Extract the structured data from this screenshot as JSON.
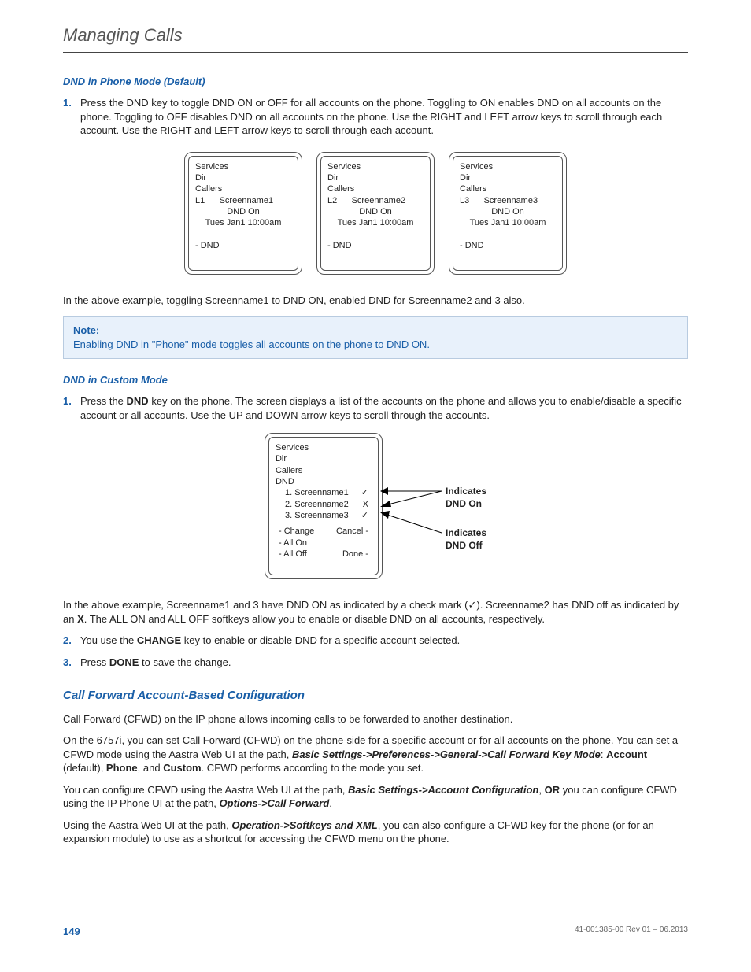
{
  "header": {
    "title": "Managing Calls"
  },
  "section1": {
    "heading": "DND in Phone Mode (Default)",
    "item1_num": "1.",
    "item1_text": "Press the DND key to toggle DND ON or OFF for all accounts on the phone. Toggling to ON enables DND on all accounts on the phone. Toggling to OFF disables DND on all accounts on the phone. Use the RIGHT and LEFT arrow keys to scroll through each account. Use the RIGHT and LEFT arrow keys to scroll through each account."
  },
  "screens": [
    {
      "services": "Services",
      "dir": "Dir",
      "callers": "Callers",
      "line": "L1",
      "name": "Screenname1",
      "dnd": "DND On",
      "time": "Tues Jan1 10:00am",
      "soft": "- DND"
    },
    {
      "services": "Services",
      "dir": "Dir",
      "callers": "Callers",
      "line": "L2",
      "name": "Screenname2",
      "dnd": "DND On",
      "time": "Tues Jan1 10:00am",
      "soft": "- DND"
    },
    {
      "services": "Services",
      "dir": "Dir",
      "callers": "Callers",
      "line": "L3",
      "name": "Screenname3",
      "dnd": "DND On",
      "time": "Tues Jan1 10:00am",
      "soft": "- DND"
    }
  ],
  "para_after_screens": "In the above example, toggling Screenname1 to DND ON, enabled DND for Screenname2 and 3 also.",
  "note": {
    "label": "Note:",
    "body": "Enabling DND in \"Phone\" mode toggles all accounts on the phone to DND ON."
  },
  "section2": {
    "heading": "DND in Custom Mode",
    "item1_num": "1.",
    "item1_pre": "Press the ",
    "item1_bold": "DND",
    "item1_post": " key on the phone. The screen displays a list of the accounts on the phone and allows you to enable/disable a specific account or all accounts. Use the UP and DOWN arrow keys to scroll through the accounts."
  },
  "custom_screen": {
    "services": "Services",
    "dir": "Dir",
    "callers": "Callers",
    "dnd_head": "DND",
    "row1_label": "1. Screenname1",
    "row1_mark": "✓",
    "row2_label": "2. Screenname2",
    "row2_mark": "X",
    "row3_label": "3. Screenname3",
    "row3_mark": "✓",
    "soft_change": "- Change",
    "soft_cancel": "Cancel -",
    "soft_allon": "- All On",
    "soft_done": "Done -",
    "soft_alloff": "- All Off"
  },
  "callouts": {
    "on_l1": "Indicates",
    "on_l2": "DND On",
    "off_l1": "Indicates",
    "off_l2": "DND Off"
  },
  "para_after_custom_1a": "In the above example, Screenname1 and 3 have DND ON as indicated by a check mark (",
  "checkmark": "✓",
  "para_after_custom_1b": "). Screenname2 has DND off as indicated by an ",
  "x_mark": "X",
  "para_after_custom_1c": ". The ALL ON and ALL OFF softkeys allow you to enable or disable DND on all accounts, respectively.",
  "section2_item2_num": "2.",
  "section2_item2_pre": "You use the ",
  "section2_item2_bold": "CHANGE",
  "section2_item2_post": " key to enable or disable DND for a specific account selected.",
  "section2_item3_num": "3.",
  "section2_item3_pre": "Press ",
  "section2_item3_bold": "DONE",
  "section2_item3_post": " to save the change.",
  "cfwd": {
    "heading": "Call Forward Account-Based Configuration",
    "p1": "Call Forward (CFWD) on the IP phone allows incoming calls to be forwarded to another destination.",
    "p2_a": "On the 6757i, you can set Call Forward (CFWD) on the phone-side for a specific account or for all accounts on the phone. You can set a CFWD mode using the Aastra Web UI at the path, ",
    "p2_b": "Basic Settings->Preferences->General->Call Forward Key Mode",
    "p2_c": ": ",
    "p2_d": "Account",
    "p2_e": " (default), ",
    "p2_f": "Phone",
    "p2_g": ", and ",
    "p2_h": "Custom",
    "p2_i": ". CFWD performs according to the mode you set.",
    "p3_a": "You can configure CFWD using the Aastra Web UI at the path, ",
    "p3_b": "Basic Settings->Account Configuration",
    "p3_c": ", ",
    "p3_d": "OR",
    "p3_e": " you can configure CFWD using the IP Phone UI at the path, ",
    "p3_f": "Options->Call Forward",
    "p3_g": ".",
    "p4_a": "Using the Aastra Web UI at the path, ",
    "p4_b": "Operation->Softkeys and XML",
    "p4_c": ", you can also configure a CFWD key for the phone (or for an expansion module) to use as a shortcut for accessing the CFWD menu on the phone."
  },
  "footer": {
    "page": "149",
    "rev": "41-001385-00 Rev 01 – 06.2013"
  }
}
